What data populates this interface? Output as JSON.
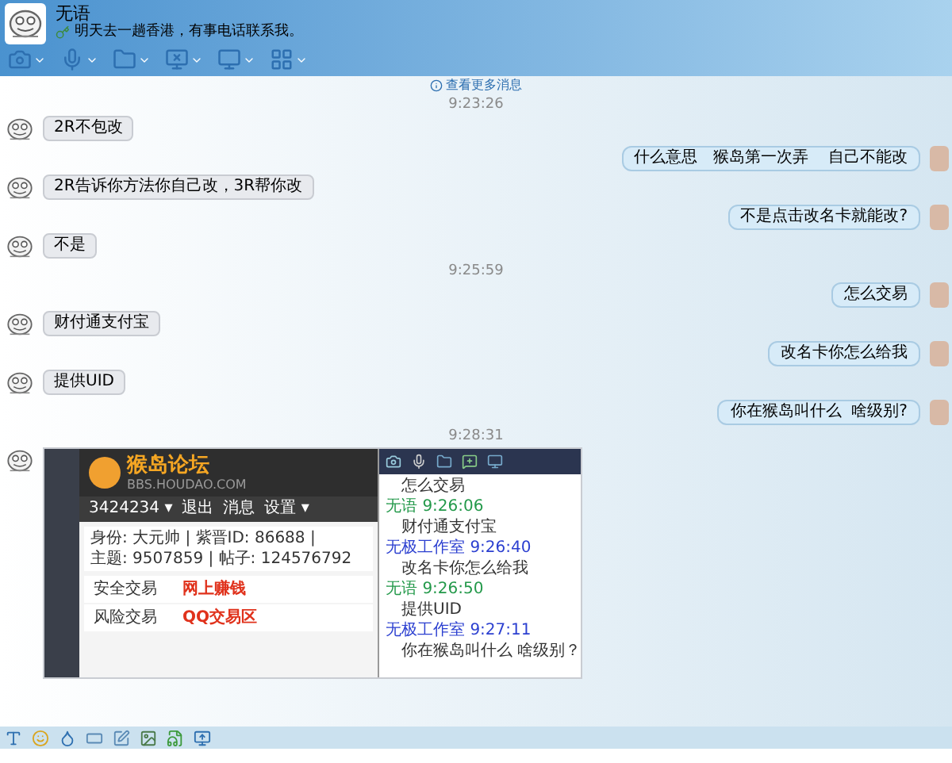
{
  "contact": {
    "name": "无语",
    "status": "明天去一趟香港，有事电话联系我。"
  },
  "more_messages_link": "查看更多消息",
  "messages": [
    {
      "kind": "time",
      "text": "9:23:26"
    },
    {
      "kind": "incoming",
      "text": "2R不包改"
    },
    {
      "kind": "outgoing",
      "text": "什么意思   猴岛第一次弄    自己不能改"
    },
    {
      "kind": "incoming",
      "text": "2R告诉你方法你自己改，3R帮你改"
    },
    {
      "kind": "outgoing",
      "text": "不是点击改名卡就能改?"
    },
    {
      "kind": "incoming",
      "text": "不是"
    },
    {
      "kind": "time",
      "text": "9:25:59"
    },
    {
      "kind": "outgoing",
      "text": "怎么交易"
    },
    {
      "kind": "incoming",
      "text": "财付通支付宝"
    },
    {
      "kind": "outgoing",
      "text": "改名卡你怎么给我"
    },
    {
      "kind": "incoming",
      "text": "提供UID"
    },
    {
      "kind": "outgoing",
      "text": "你在猴岛叫什么  啥级别?"
    },
    {
      "kind": "time",
      "text": "9:28:31"
    },
    {
      "kind": "screenshot"
    }
  ],
  "screenshot": {
    "forum": {
      "logo": "猴岛论坛",
      "domain": "BBS.HOUDAO.COM",
      "nav": [
        "3424234 ▾",
        "退出",
        "消息",
        "设置 ▾"
      ],
      "info_lines": [
        "身份: 大元帅 | 紫晋ID: 86688 |",
        "主题: 9507859 | 帖子: 124576792"
      ],
      "menu": [
        {
          "label": "安全交易",
          "link": "网上赚钱"
        },
        {
          "label": "风险交易",
          "link": "QQ交易区"
        }
      ]
    },
    "chat_lines": [
      {
        "kind": "text",
        "text": "怎么交易"
      },
      {
        "kind": "sender",
        "name": "无语",
        "time": "9:26:06",
        "color": "#23994a"
      },
      {
        "kind": "text",
        "text": "财付通支付宝"
      },
      {
        "kind": "sender",
        "name": "无极工作室",
        "time": "9:26:40",
        "color": "#2b3fd0"
      },
      {
        "kind": "text",
        "text": "改名卡你怎么给我"
      },
      {
        "kind": "sender",
        "name": "无语",
        "time": "9:26:50",
        "color": "#23994a"
      },
      {
        "kind": "text",
        "text": "提供UID"
      },
      {
        "kind": "sender",
        "name": "无极工作室",
        "time": "9:27:11",
        "color": "#2b3fd0"
      },
      {
        "kind": "text",
        "text": "你在猴岛叫什么 啥级别？"
      }
    ]
  }
}
